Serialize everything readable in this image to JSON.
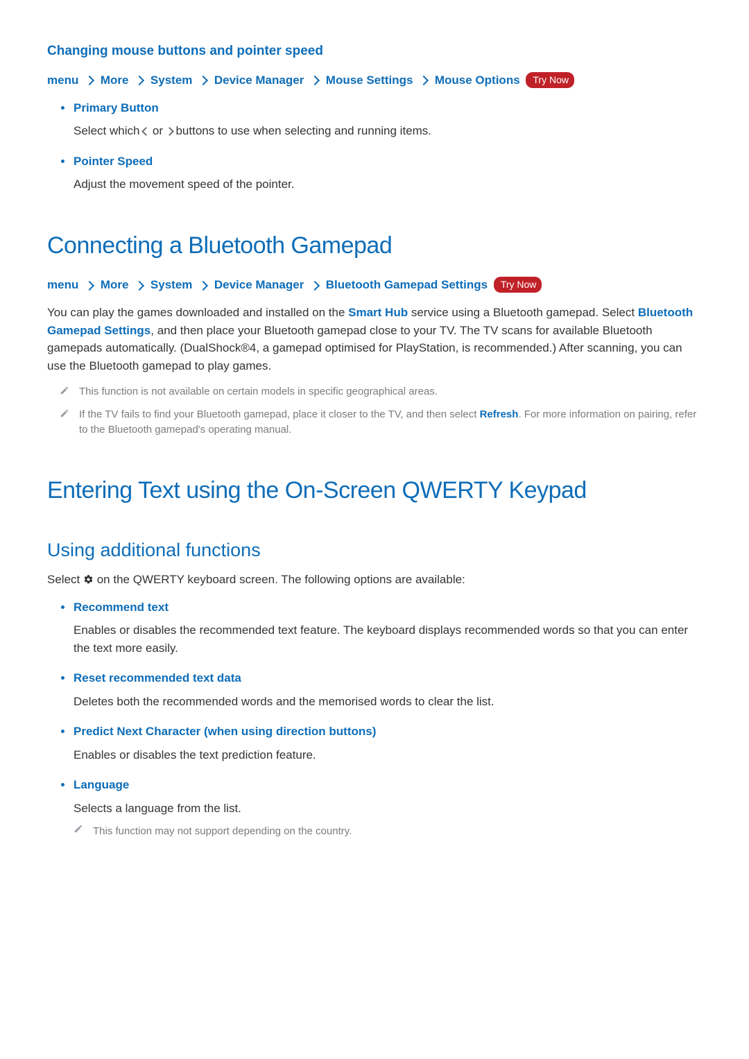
{
  "section1": {
    "heading": "Changing mouse buttons and pointer speed",
    "crumbs": [
      "menu",
      "More",
      "System",
      "Device Manager",
      "Mouse Settings",
      "Mouse Options"
    ],
    "try_now": "Try Now",
    "items": [
      {
        "title": "Primary Button",
        "desc_pre": "Select which ",
        "desc_post": " buttons to use when selecting and running items."
      },
      {
        "title": "Pointer Speed",
        "desc": "Adjust the movement speed of the pointer."
      }
    ]
  },
  "section2": {
    "heading": "Connecting a Bluetooth Gamepad",
    "crumbs": [
      "menu",
      "More",
      "System",
      "Device Manager",
      "Bluetooth Gamepad Settings"
    ],
    "try_now": "Try Now",
    "para_a": "You can play the games downloaded and installed on the ",
    "smart_hub": "Smart Hub",
    "para_b": " service using a Bluetooth gamepad. Select ",
    "bt_settings": "Bluetooth Gamepad Settings",
    "para_c": ", and then place your Bluetooth gamepad close to your TV. The TV scans for available Bluetooth gamepads automatically. (DualShock®4, a gamepad optimised for PlayStation, is recommended.) After scanning, you can use the Bluetooth gamepad to play games.",
    "note1": "This function is not available on certain models in specific geographical areas.",
    "note2_a": "If the TV fails to find your Bluetooth gamepad, place it closer to the TV, and then select ",
    "refresh": "Refresh",
    "note2_b": ". For more information on pairing, refer to the Bluetooth gamepad's operating manual."
  },
  "section3": {
    "heading": "Entering Text using the On-Screen QWERTY Keypad",
    "sub_heading": "Using additional functions",
    "intro_a": "Select ",
    "intro_b": " on the QWERTY keyboard screen. The following options are available:",
    "items": [
      {
        "title": "Recommend text",
        "desc": "Enables or disables the recommended text feature. The keyboard displays recommended words so that you can enter the text more easily."
      },
      {
        "title": "Reset recommended text data",
        "desc": "Deletes both the recommended words and the memorised words to clear the list."
      },
      {
        "title": "Predict Next Character (when using direction buttons)",
        "desc": "Enables or disables the text prediction feature."
      },
      {
        "title": "Language",
        "desc": "Selects a language from the list.",
        "note": "This function may not support depending on the country."
      }
    ]
  },
  "labels": {
    "or": " or "
  }
}
